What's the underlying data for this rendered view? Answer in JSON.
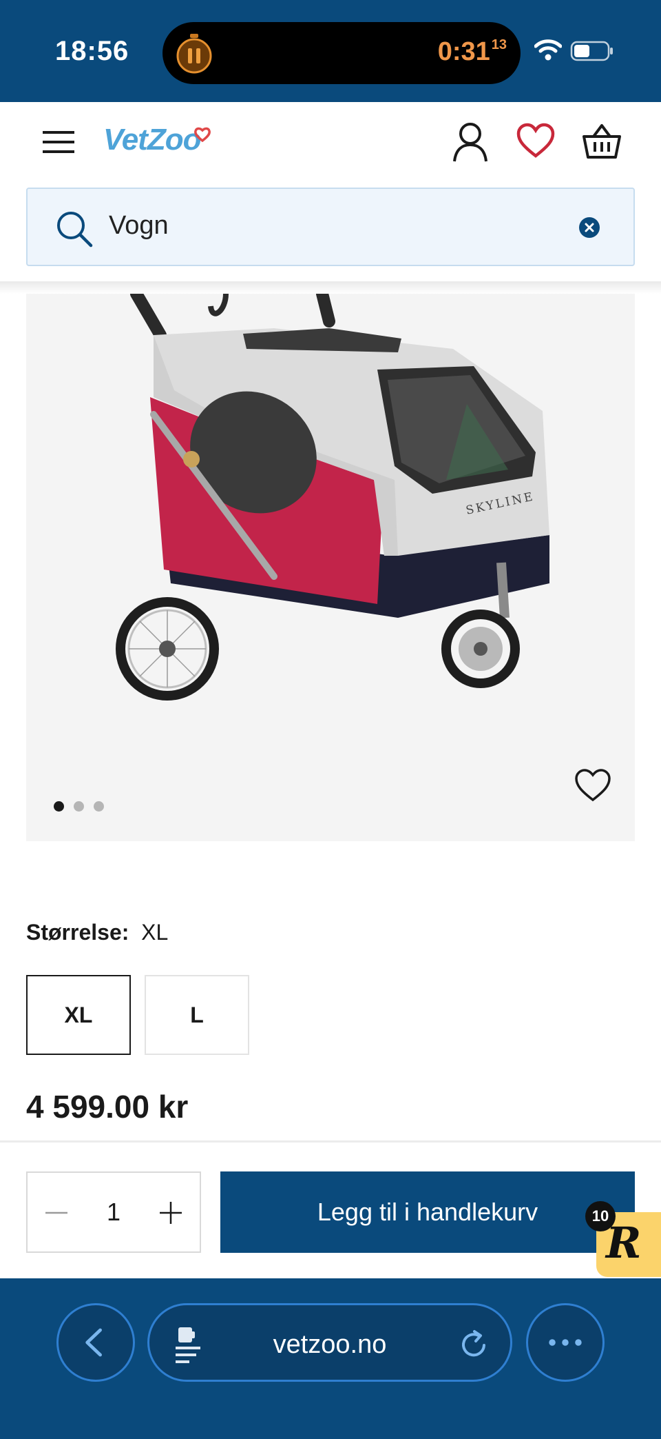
{
  "status_bar": {
    "time": "18:56",
    "timer": "0:31",
    "timer_fraction": "13"
  },
  "header": {
    "logo": "VetZoo"
  },
  "search": {
    "query": "Vogn"
  },
  "gallery": {
    "image_brand_text": "SKYLINE",
    "dot_count": 3,
    "active_dot": 0
  },
  "product": {
    "size_label": "Størrelse:",
    "selected_size": "XL",
    "size_options": [
      "XL",
      "L"
    ],
    "price": "4 599.00 kr"
  },
  "cart": {
    "quantity": "1",
    "add_button": "Legg til i handlekurv",
    "badge_letter": "R",
    "badge_count": "10"
  },
  "browser": {
    "url": "vetzoo.no"
  },
  "colors": {
    "brand_navy": "#0a4a7c",
    "logo_blue": "#4ea3d8",
    "wishlist_red": "#c8283a",
    "timer_orange": "#f0974a",
    "badge_yellow": "#fbd36b"
  }
}
